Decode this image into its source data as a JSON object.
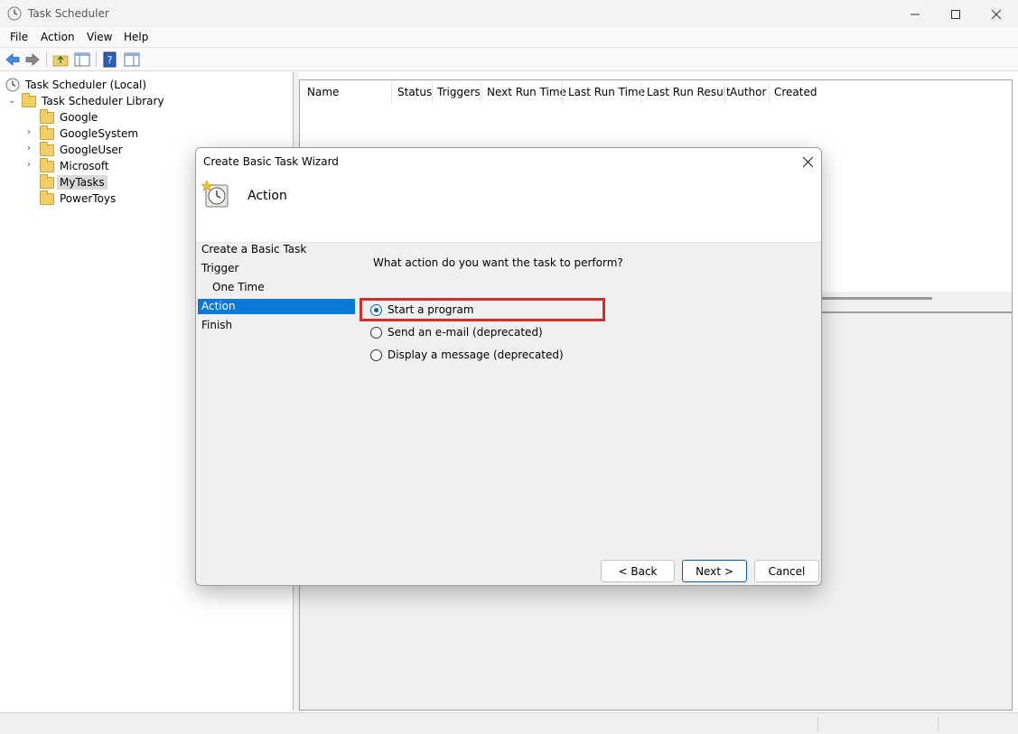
{
  "window": {
    "title": "Task Scheduler"
  },
  "menu": {
    "items": [
      "File",
      "Action",
      "View",
      "Help"
    ]
  },
  "tree": {
    "root": "Task Scheduler (Local)",
    "library": "Task Scheduler Library",
    "folders": [
      "Google",
      "GoogleSystem",
      "GoogleUser",
      "Microsoft",
      "MyTasks",
      "PowerToys"
    ]
  },
  "task_list": {
    "columns": [
      "Name",
      "Status",
      "Triggers",
      "Next Run Time",
      "Last Run Time",
      "Last Run Result",
      "Author",
      "Created"
    ]
  },
  "dialog": {
    "title": "Create Basic Task Wizard",
    "header": "Action",
    "steps": [
      "Create a Basic Task",
      "Trigger",
      "One Time",
      "Action",
      "Finish"
    ],
    "active_step": "Action",
    "question": "What action do you want the task to perform?",
    "options": [
      "Start a program",
      "Send an e-mail (deprecated)",
      "Display a message (deprecated)"
    ],
    "selected_option": "Start a program",
    "buttons": {
      "back": "< Back",
      "next": "Next >",
      "cancel": "Cancel"
    },
    "highlight_color": "#d42d2d",
    "accent_color": "#0a78d7"
  }
}
